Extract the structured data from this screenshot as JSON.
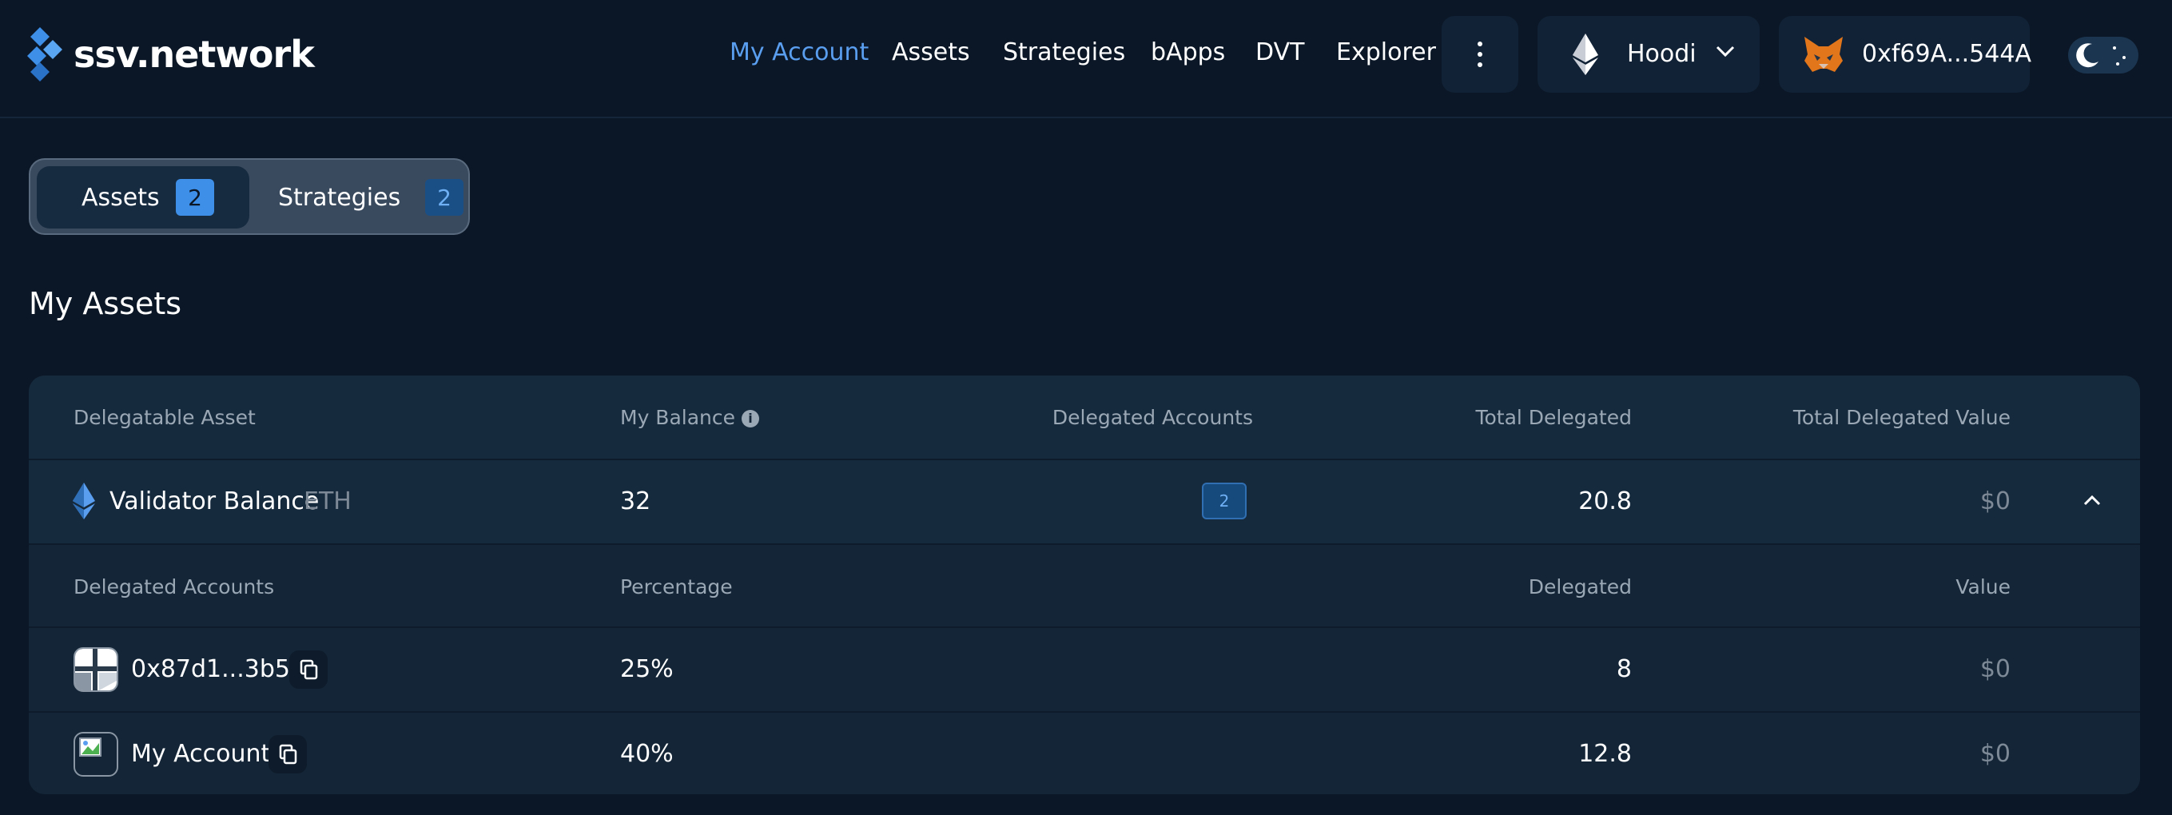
{
  "header": {
    "logo_text": "ssv.network",
    "nav": [
      {
        "label": "My Account",
        "active": true
      },
      {
        "label": "Assets",
        "active": false
      },
      {
        "label": "Strategies",
        "active": false
      },
      {
        "label": "bApps",
        "active": false
      },
      {
        "label": "DVT",
        "active": false
      },
      {
        "label": "Explorer",
        "active": false
      }
    ],
    "more_icon": "kebab-menu-icon",
    "network": {
      "label": "Hoodi",
      "icon": "ethereum-icon",
      "chevron": "chevron-down-icon"
    },
    "wallet": {
      "address": "0xf69A...544A",
      "icon": "metamask-fox-icon"
    },
    "theme_toggle_icon": "moon-icon"
  },
  "tabs": [
    {
      "label": "Assets",
      "count": "2",
      "active": true
    },
    {
      "label": "Strategies",
      "count": "2",
      "active": false
    }
  ],
  "section_title": "My Assets",
  "table": {
    "columns": {
      "asset": "Delegatable Asset",
      "balance": "My Balance",
      "accounts": "Delegated Accounts",
      "total": "Total Delegated",
      "value": "Total Delegated Value"
    },
    "asset_row": {
      "name": "Validator Balance",
      "symbol": "ETH",
      "balance": "32",
      "accounts_count": "2",
      "total_delegated": "20.8",
      "total_value": "$0",
      "expand_icon": "chevron-up-icon"
    },
    "sub_columns": {
      "accounts": "Delegated Accounts",
      "percentage": "Percentage",
      "delegated": "Delegated",
      "value": "Value"
    },
    "accounts": [
      {
        "name": "0x87d1...3b54",
        "percentage": "25%",
        "delegated": "8",
        "value": "$0"
      },
      {
        "name": "My Account",
        "percentage": "40%",
        "delegated": "12.8",
        "value": "$0"
      }
    ]
  },
  "colors": {
    "background": "#0b1726",
    "accent": "#5a9ef0",
    "badge": "#3d8fe8"
  }
}
